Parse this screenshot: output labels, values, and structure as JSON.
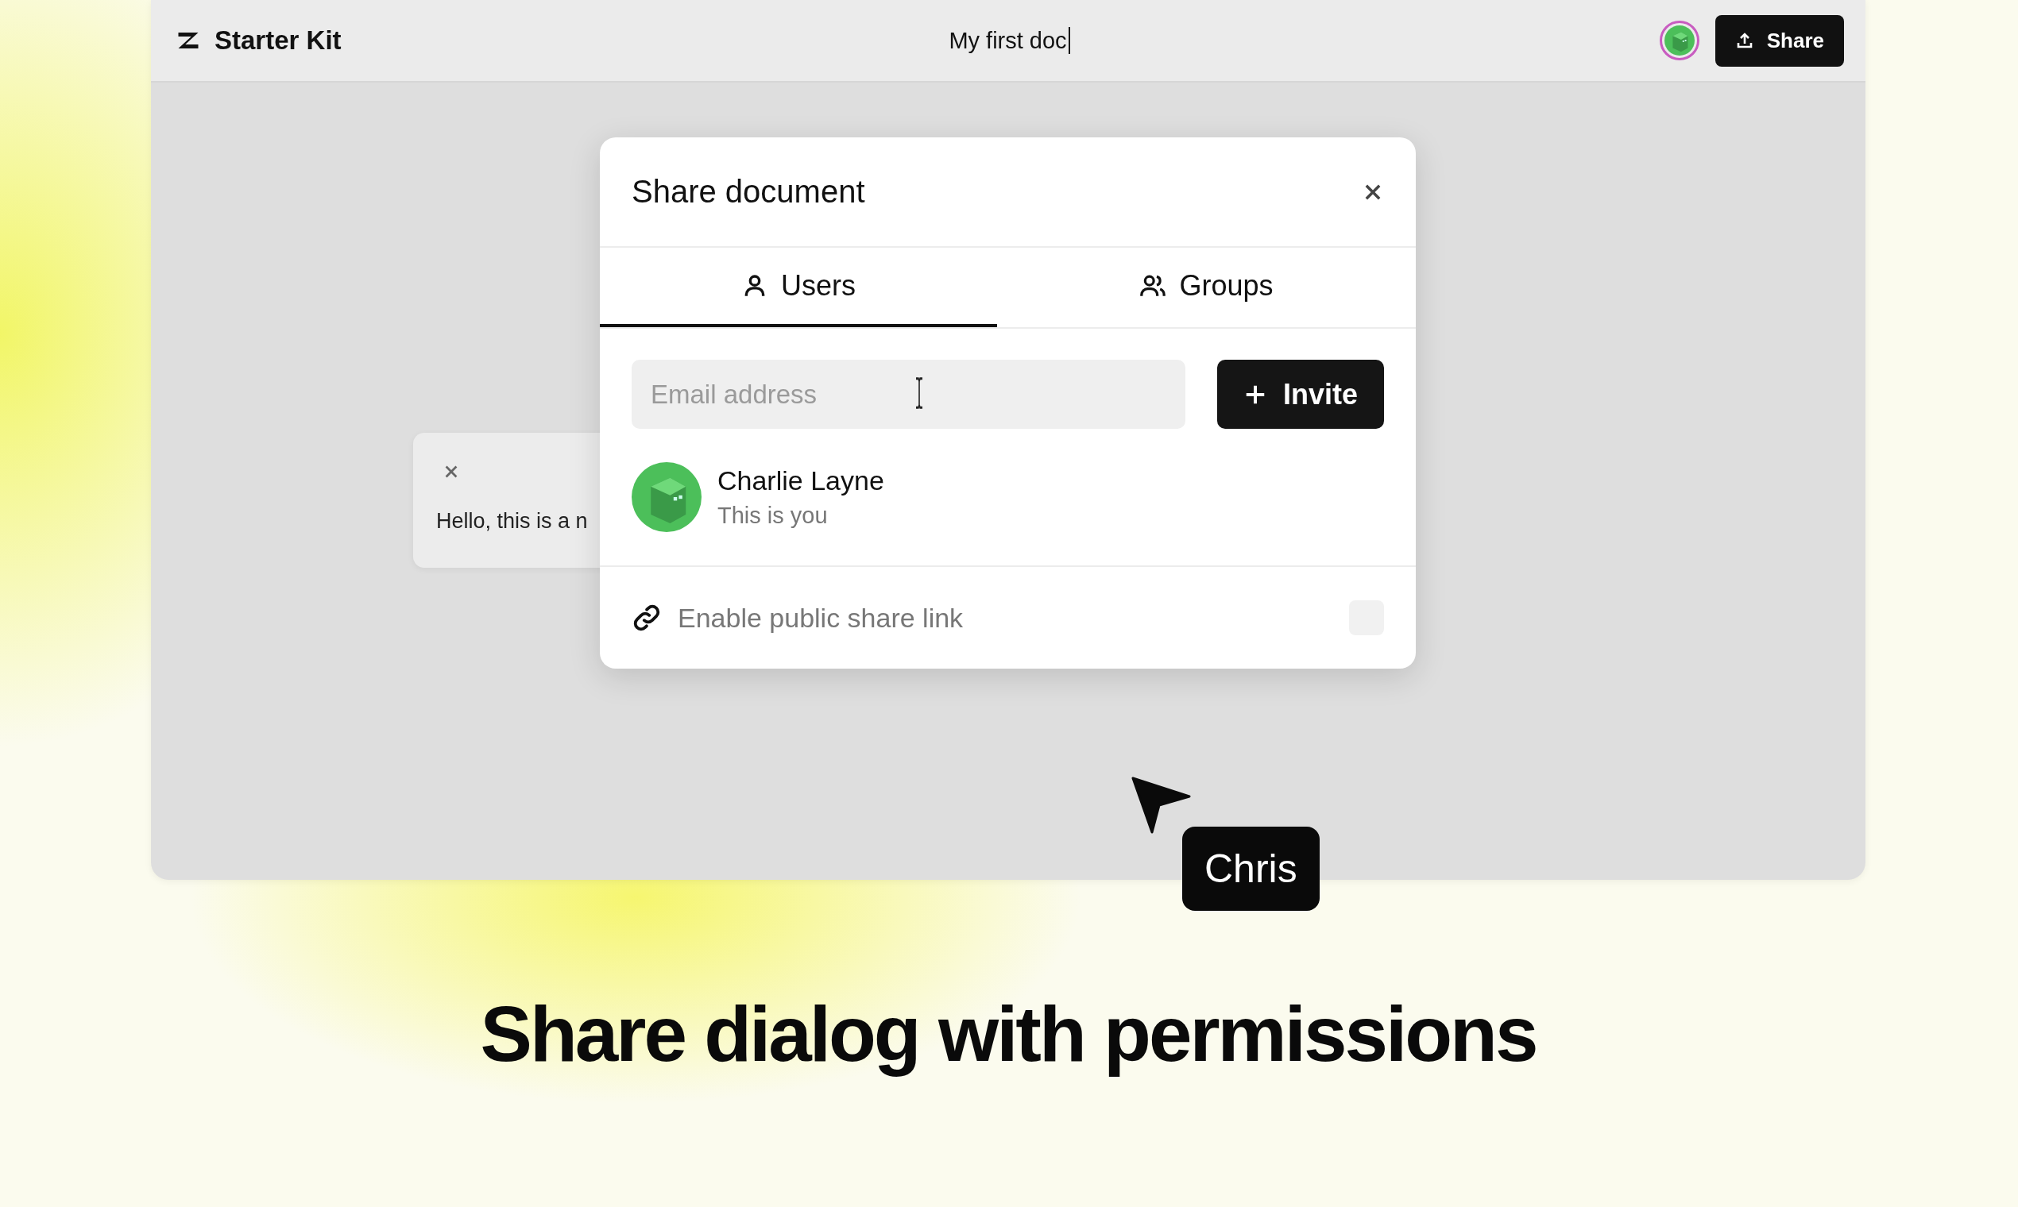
{
  "app": {
    "brand": "Starter Kit",
    "doc_title": "My first doc",
    "share_button": "Share"
  },
  "comment": {
    "text": "Hello, this is a n"
  },
  "dialog": {
    "title": "Share document",
    "tabs": [
      {
        "label": "Users",
        "kind": "user",
        "selected": true
      },
      {
        "label": "Groups",
        "kind": "group",
        "selected": false
      }
    ],
    "email": {
      "placeholder": "Email address"
    },
    "invite_button": "Invite",
    "members": [
      {
        "name": "Charlie Layne",
        "note": "This is you"
      }
    ],
    "public_link": {
      "label": "Enable public share link",
      "on": false
    }
  },
  "cursor": {
    "label": "Chris"
  },
  "caption": "Share dialog with permissions"
}
